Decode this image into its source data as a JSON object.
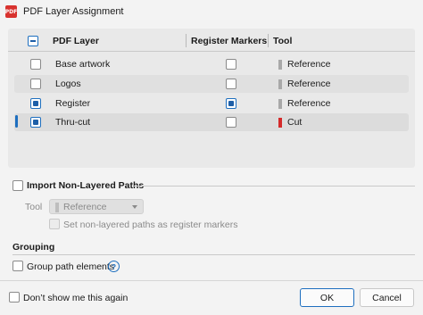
{
  "window": {
    "icon_text": "PDF",
    "title": "PDF Layer Assignment"
  },
  "table": {
    "headers": {
      "layer": "PDF Layer",
      "register": "Register Markers",
      "tool": "Tool"
    },
    "rows": [
      {
        "name": "Base artwork",
        "layer_checked": false,
        "register_checked": false,
        "tool": "Reference",
        "tool_color": "#a8a8a8"
      },
      {
        "name": "Logos",
        "layer_checked": false,
        "register_checked": false,
        "tool": "Reference",
        "tool_color": "#a8a8a8"
      },
      {
        "name": "Register",
        "layer_checked": true,
        "register_checked": true,
        "tool": "Reference",
        "tool_color": "#a8a8a8"
      },
      {
        "name": "Thru-cut",
        "layer_checked": true,
        "register_checked": false,
        "tool": "Cut",
        "tool_color": "#d42a2a"
      }
    ],
    "selected_row": "Thru-cut"
  },
  "non_layered": {
    "title": "Import Non-Layered Paths",
    "tool_label": "Tool",
    "tool_value": "Reference",
    "register_option": "Set non-layered paths as register markers"
  },
  "grouping": {
    "title": "Grouping",
    "group_option": "Group path elements",
    "help_text": "?"
  },
  "footer": {
    "dont_show": "Don’t show me this again",
    "ok": "OK",
    "cancel": "Cancel"
  },
  "colors": {
    "accent": "#1e6fbf",
    "reference": "#a8a8a8",
    "cut": "#d42a2a"
  }
}
